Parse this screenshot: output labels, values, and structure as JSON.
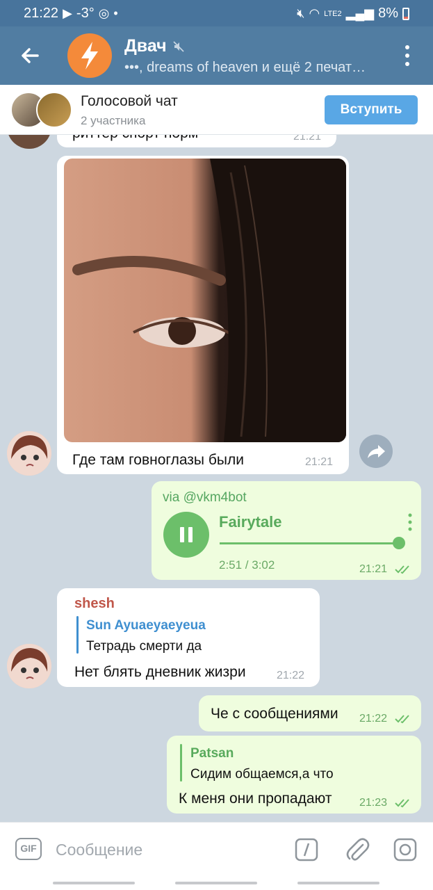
{
  "status": {
    "time": "21:22",
    "temperature": "-3°",
    "battery": "8%",
    "network": "LTE2"
  },
  "header": {
    "title": "Двач",
    "subtitle": "•••, dreams of heaven и ещё 2 печат…"
  },
  "voice_chat": {
    "title": "Голосовой чат",
    "participants": "2 участника",
    "join_label": "Вступить"
  },
  "messages": {
    "partial": {
      "text": "риттер спорт норм",
      "time": "21:21"
    },
    "photo": {
      "caption": "Где там говноглазы были",
      "time": "21:21"
    },
    "audio": {
      "via": "via @vkm4bot",
      "title": "Fairytale",
      "duration": "2:51 / 3:02",
      "progress": 0.94,
      "time": "21:21"
    },
    "reply_in": {
      "sender": "shesh",
      "reply_name": "Sun Ayuaeyaeyeua",
      "reply_text": "Тетрадь смерти да",
      "text": "Нет блять дневник жизри",
      "time": "21:22"
    },
    "out1": {
      "text": "Че с сообщениями",
      "time": "21:22"
    },
    "out2": {
      "reply_name": "Patsan",
      "reply_text": "Сидим общаемся,а что",
      "text": "К меня они пропадают",
      "time": "21:23"
    }
  },
  "input": {
    "placeholder": "Сообщение",
    "gif_label": "GIF"
  },
  "colors": {
    "header": "#517da2",
    "accent_green": "#6cbf6a",
    "join_button": "#59a7e5",
    "sender_name": "#c0574a",
    "reply_blue": "#3f8fd0"
  }
}
